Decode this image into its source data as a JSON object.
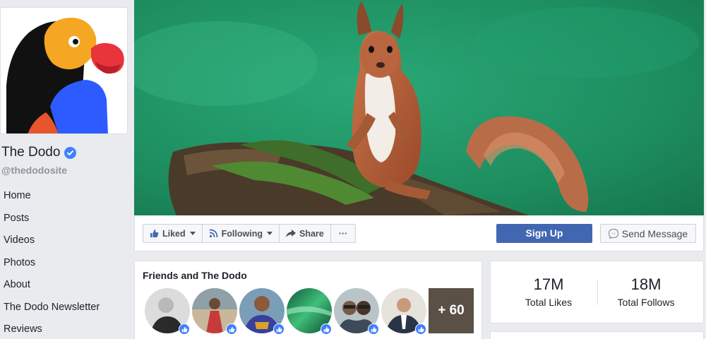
{
  "page": {
    "name": "The Dodo",
    "handle": "@thedodosite"
  },
  "nav": {
    "items": [
      {
        "label": "Home"
      },
      {
        "label": "Posts"
      },
      {
        "label": "Videos"
      },
      {
        "label": "Photos"
      },
      {
        "label": "About"
      },
      {
        "label": "The Dodo Newsletter"
      },
      {
        "label": "Reviews"
      }
    ]
  },
  "actions": {
    "liked": "Liked",
    "following": "Following",
    "share": "Share",
    "more": "···",
    "signup": "Sign Up",
    "send_message": "Send Message"
  },
  "friends": {
    "title": "Friends and The Dodo",
    "more_count": "+ 60"
  },
  "stats": {
    "likes_value": "17M",
    "likes_label": "Total Likes",
    "follows_value": "18M",
    "follows_label": "Total Follows"
  },
  "colors": {
    "brand_blue": "#4267b2",
    "verified": "#4080ff",
    "background": "#e9ebee"
  }
}
